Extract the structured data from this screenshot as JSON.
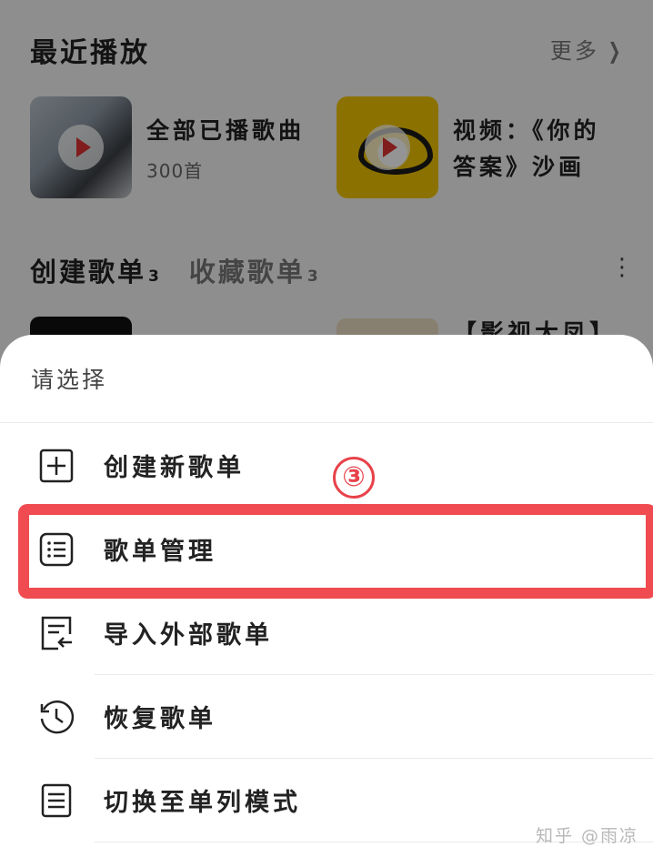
{
  "recent": {
    "title": "最近播放",
    "more_label": "更多",
    "cards": [
      {
        "title": "全部已播歌曲",
        "subtitle": "300首"
      },
      {
        "title_line1": "视频：《你的",
        "title_line2": "答案》沙画"
      }
    ]
  },
  "playlist_tabs": [
    {
      "label": "创建歌单",
      "count": "3"
    },
    {
      "label": "收藏歌单",
      "count": "3"
    }
  ],
  "peek_item_title": "【影视大凤】",
  "sheet": {
    "title": "请选择",
    "annotation": "③",
    "items": [
      {
        "label": "创建新歌单",
        "icon": "plus-square-icon"
      },
      {
        "label": "歌单管理",
        "icon": "list-icon"
      },
      {
        "label": "导入外部歌单",
        "icon": "import-icon"
      },
      {
        "label": "恢复歌单",
        "icon": "history-icon"
      },
      {
        "label": "切换至单列模式",
        "icon": "single-column-icon"
      }
    ]
  },
  "watermark": "知乎 @雨凉",
  "colors": {
    "highlight": "#ef4b50",
    "play": "#dd3333"
  }
}
